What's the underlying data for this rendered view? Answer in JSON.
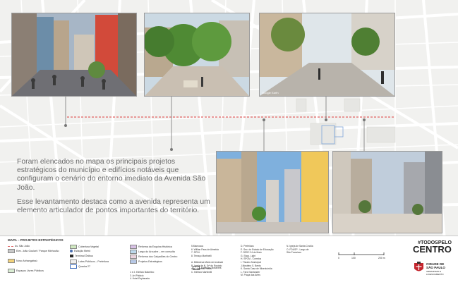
{
  "intro_text": [
    "Foram elencados no mapa os principais projetos estratégicos do município e edifícios notáveis que configuram o cenário do entorno imediato da Avenida São João.",
    "Esse levantamento destaca como a avenida representa um elemento articulador de pontos importantes do território."
  ],
  "photos": [
    {
      "id": "minhocao",
      "credit": ""
    },
    {
      "id": "bulevar",
      "credit": ""
    },
    {
      "id": "avenida-trees",
      "credit": "Google Earth"
    },
    {
      "id": "vale-anhangabau",
      "credit": ""
    },
    {
      "id": "praca-ramos",
      "credit": ""
    }
  ],
  "legend": {
    "title": "MAPA – PROJETOS ESTRATÉGICOS",
    "items": [
      {
        "label": "Av. São João",
        "color": "#e06a6a"
      },
      {
        "label": "Elev. João Goulart / Parque Minhocão",
        "color": "#c9c9c9"
      },
      {
        "label": "Novo Anhangabaú",
        "color": "#f2d27a"
      },
      {
        "label": "Espaços Livres Públicos",
        "color": "#d9ecd2"
      },
      {
        "label": "Cobertura Vegetal",
        "color": "#cfe7c0"
      },
      {
        "label": "Estação Metrô",
        "color": "#4a6fb0"
      },
      {
        "label": "Terminal Ônibus",
        "color": "#2b2b2b"
      },
      {
        "label": "Lotes Públicos – Prefeitura",
        "color": "#eeeeee"
      },
      {
        "label": "Quadra 27",
        "color": "#3a68b8"
      },
      {
        "label": "Reforma da Esquina Histórica",
        "color": "#d7c0e4"
      },
      {
        "label": "Largo do Arouche – em consulta",
        "color": "#bcd8ec"
      },
      {
        "label": "Reforma dos Calçadões do Centro",
        "color": "#ebd4df"
      },
      {
        "label": "Projetos Estratégicos",
        "color": "#b7c8e6"
      },
      {
        "label": "Edifícios Notáveis",
        "color": "#ffffff"
      }
    ],
    "col1": [
      "1 e 2. Edifício Balcelino",
      "3. Art Palácio",
      "4. Hotel Esplanada"
    ],
    "col2": [
      "5.Mamocca",
      "6. Willian Pass de Almeida",
      "7. SP24",
      "8. Terraço Martinelli",
      "",
      "A. Biblioteca Mário de Andrade",
      "B. Igreja de N. Srª do Rosário",
      "   dos Homens Pretos",
      "C. Edifício Martinelli"
    ],
    "col3": [
      "D. Prefeitura",
      "E. Sec. do Estado de Educação",
      "F. SESC 24 de Maio",
      "G. Shop. Light",
      "H. SPCM - Correios",
      "I. Theatro Municipal",
      "J.Mosteiro S. Bento",
      "K. Santa Casa de Misericórdia",
      "L. Farol Santander",
      "M. Praça das Artes"
    ],
    "col4": [
      "N. Igreja de Santa Cecília",
      "O. FDUSP - Largo de",
      "   São Francisco"
    ]
  },
  "scale": {
    "labels": [
      "0",
      "100",
      "200 m"
    ]
  },
  "brand": {
    "hashtag": "#TODOSPELO",
    "word": "CENTRO",
    "city1": "CIDADE DE",
    "city2": "SÃO PAULO",
    "dept": "URBANISMO E LICENCIAMENTO"
  }
}
